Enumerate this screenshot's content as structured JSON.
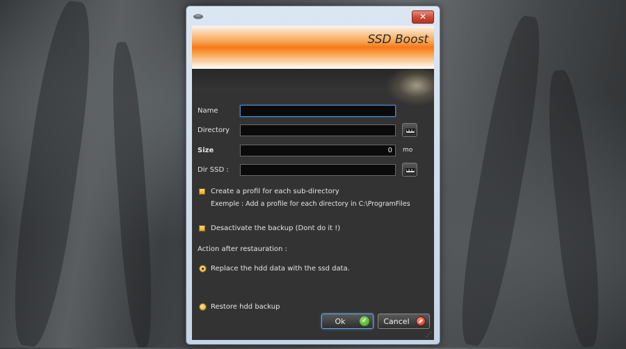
{
  "dialog": {
    "title": "SSD Boost",
    "close_label": "✕",
    "fields": {
      "name": {
        "label": "Name",
        "value": ""
      },
      "directory": {
        "label": "Directory",
        "value": ""
      },
      "size": {
        "label": "Size",
        "value": "0",
        "unit": "mo"
      },
      "dir_ssd": {
        "label": "Dir SSD :",
        "value": ""
      }
    },
    "checkboxes": {
      "create_profile": {
        "label": "Create a profil for each sub-directory",
        "hint": "Exemple : Add a profile for each directory in C:\\ProgramFiles",
        "checked": false
      },
      "deactivate_backup": {
        "label": "Desactivate the backup (Dont do it !)",
        "checked": false
      }
    },
    "action_label": "Action after restauration :",
    "radios": {
      "replace": {
        "label": "Replace the hdd data with the ssd data.",
        "selected": true
      },
      "restore": {
        "label": "Restore hdd backup",
        "selected": false
      }
    },
    "buttons": {
      "ok": "Ok",
      "cancel": "Cancel"
    },
    "browse_glyph": "▪▪▪",
    "accent_color": "#4a86c5",
    "banner_color": "#f47a18"
  }
}
